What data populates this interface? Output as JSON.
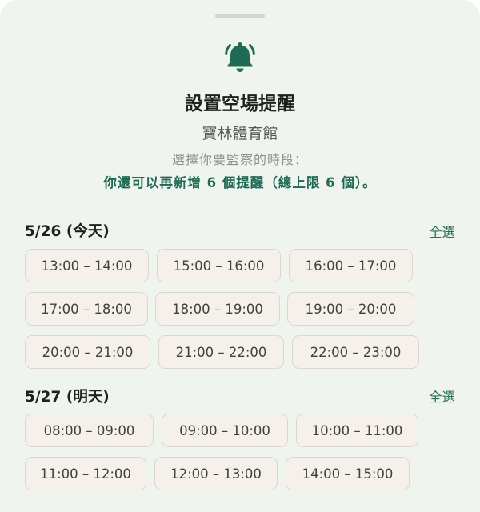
{
  "handle_label": "",
  "icon": "bell-icon",
  "accent_color": "#1f6a55",
  "title": "設置空場提醒",
  "venue": "寶林體育館",
  "prompt": "選擇你要監察的時段：",
  "quota": "你還可以再新增 6 個提醒（總上限 6 個）。",
  "days": [
    {
      "heading": "5/26 (今天)",
      "select_all": "全選",
      "slots": [
        "13:00 – 14:00",
        "15:00 – 16:00",
        "16:00 – 17:00",
        "17:00 – 18:00",
        "18:00 – 19:00",
        "19:00 – 20:00",
        "20:00 – 21:00",
        "21:00 – 22:00",
        "22:00 – 23:00"
      ]
    },
    {
      "heading": "5/27 (明天)",
      "select_all": "全選",
      "slots": [
        "08:00 – 09:00",
        "09:00 – 10:00",
        "10:00 – 11:00",
        "11:00 – 12:00",
        "12:00 – 13:00",
        "14:00 – 15:00"
      ]
    }
  ]
}
